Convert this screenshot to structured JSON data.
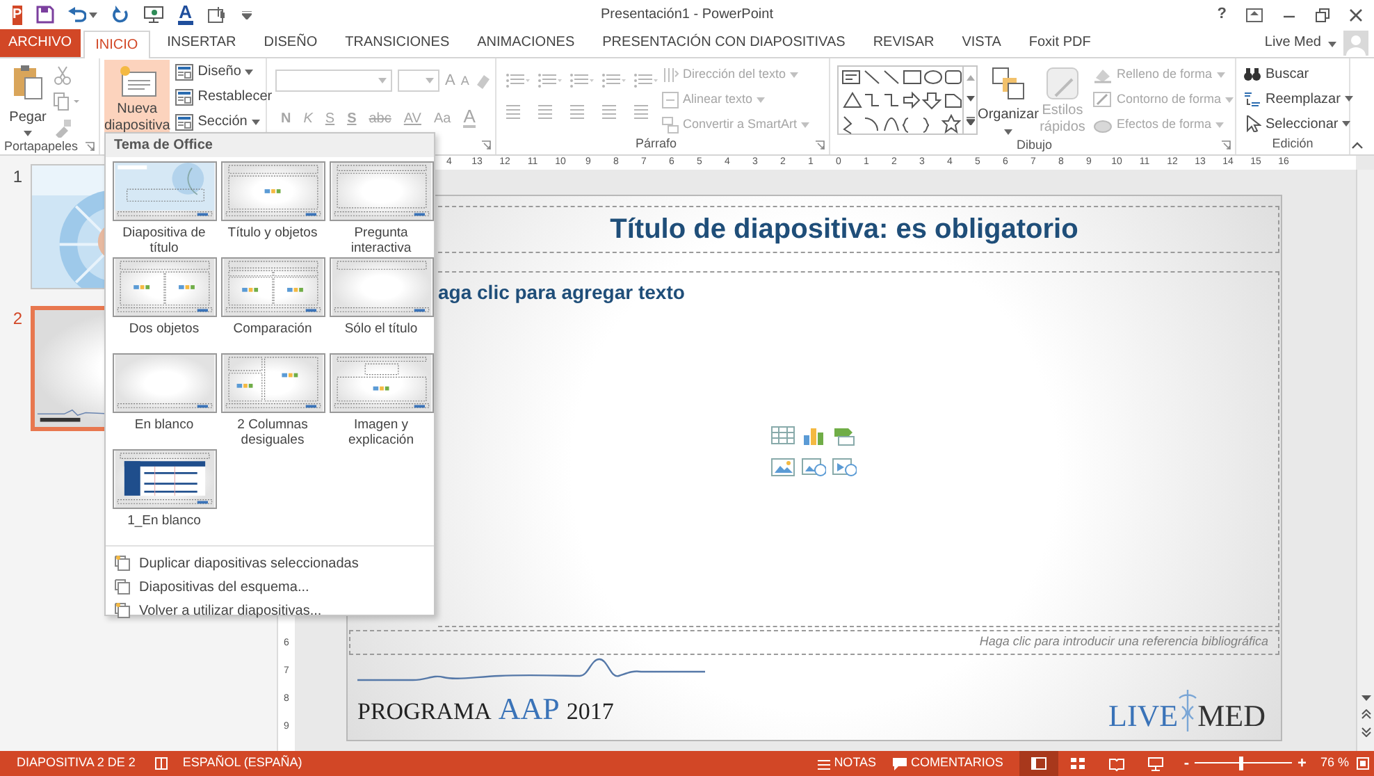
{
  "quick_access": [
    {
      "kind": "app",
      "label": "P"
    },
    {
      "kind": "save"
    },
    {
      "kind": "undo"
    },
    {
      "kind": "redo"
    },
    {
      "kind": "slideshow"
    },
    {
      "kind": "font_color",
      "label": "A"
    },
    {
      "kind": "touch"
    },
    {
      "kind": "customize"
    }
  ],
  "window": {
    "title": "Presentación1 - PowerPoint",
    "help": "?"
  },
  "tabs": [
    {
      "label": "ARCHIVO",
      "kind": "file",
      "selected": false
    },
    {
      "label": "INICIO",
      "kind": "tab",
      "selected": true
    },
    {
      "label": "INSERTAR",
      "kind": "tab",
      "selected": false
    },
    {
      "label": "DISEÑO",
      "kind": "tab",
      "selected": false
    },
    {
      "label": "TRANSICIONES",
      "kind": "tab",
      "selected": false
    },
    {
      "label": "ANIMACIONES",
      "kind": "tab",
      "selected": false
    },
    {
      "label": "PRESENTACIÓN CON DIAPOSITIVAS",
      "kind": "tab",
      "selected": false
    },
    {
      "label": "REVISAR",
      "kind": "tab",
      "selected": false
    },
    {
      "label": "VISTA",
      "kind": "tab",
      "selected": false
    },
    {
      "label": "Foxit PDF",
      "kind": "tab",
      "selected": false
    }
  ],
  "account": {
    "name": "Live Med"
  },
  "ribbon": {
    "clipboard": {
      "paste": "Pegar",
      "label": "Portapapeles"
    },
    "slides": {
      "new_slide": {
        "label": "Nueva diapositiva",
        "expanded": true
      },
      "items": [
        {
          "label": "Diseño",
          "dropdown": true
        },
        {
          "label": "Restablecer",
          "dropdown": false
        },
        {
          "label": "Sección",
          "dropdown": true
        }
      ]
    },
    "font": {
      "disabled": true,
      "grow": "A",
      "shrink": "A",
      "buttons": [
        {
          "label": "N",
          "kind": "bold"
        },
        {
          "label": "K",
          "kind": "italic"
        },
        {
          "label": "S",
          "kind": "underline"
        },
        {
          "label": "S",
          "kind": "shadow"
        },
        {
          "label": "abc",
          "kind": "strike"
        },
        {
          "label": "AV",
          "kind": "spacing"
        },
        {
          "label": "Aa",
          "kind": "case"
        },
        {
          "label": "A",
          "kind": "color"
        }
      ]
    },
    "paragraph": {
      "disabled": true,
      "label": "Párrafo",
      "items": [
        {
          "label": "Dirección del texto",
          "kind": "direction"
        },
        {
          "label": "Alinear texto",
          "kind": "align"
        },
        {
          "label": "Convertir a SmartArt",
          "kind": "smartart"
        }
      ]
    },
    "drawing": {
      "label": "Dibujo",
      "arrange": "Organizar",
      "quick_styles": {
        "label": "Estilos rápidos",
        "disabled": true
      },
      "items": [
        {
          "label": "Relleno de forma",
          "kind": "fill",
          "disabled": true
        },
        {
          "label": "Contorno de forma",
          "kind": "outline",
          "disabled": true
        },
        {
          "label": "Efectos de forma",
          "kind": "effects",
          "disabled": true
        }
      ]
    },
    "editing": {
      "label": "Edición",
      "items": [
        {
          "label": "Buscar",
          "kind": "find",
          "dropdown": false
        },
        {
          "label": "Reemplazar",
          "kind": "replace",
          "dropdown": true
        },
        {
          "label": "Seleccionar",
          "kind": "select",
          "dropdown": true
        }
      ]
    }
  },
  "slide_thumbnails": [
    {
      "number": "1",
      "kind": "picture",
      "selected": false
    },
    {
      "number": "2",
      "kind": "slide",
      "selected": true
    }
  ],
  "ruler": {
    "horizontal": [
      "4",
      "13",
      "12",
      "11",
      "10",
      "9",
      "8",
      "7",
      "6",
      "5",
      "4",
      "3",
      "2",
      "1",
      "0",
      "1",
      "2",
      "3",
      "4",
      "5",
      "6",
      "7",
      "8",
      "9",
      "10",
      "11",
      "12",
      "13",
      "14",
      "15",
      "16"
    ],
    "vertical": [
      "6",
      "7",
      "8",
      "9"
    ]
  },
  "slide": {
    "title": "Título de diapositiva: es obligatorio",
    "body": "aga clic para agregar texto",
    "reference": "Haga clic para introducir una referencia bibliográfica",
    "logo": [
      "PROGRAMA",
      "AAP",
      "2017"
    ],
    "brand": [
      "LIVE",
      "MED"
    ]
  },
  "layout_menu": {
    "header": "Tema de Office",
    "layouts": [
      {
        "label": "Diapositiva de título",
        "kind": "title"
      },
      {
        "label": "Título y objetos",
        "kind": "title_content"
      },
      {
        "label": "Pregunta interactiva",
        "kind": "question"
      },
      {
        "label": "Dos objetos",
        "kind": "two_content"
      },
      {
        "label": "Comparación",
        "kind": "comparison"
      },
      {
        "label": "Sólo el título",
        "kind": "title_only"
      },
      {
        "label": "En blanco",
        "kind": "blank"
      },
      {
        "label": "2 Columnas desiguales",
        "kind": "two_columns"
      },
      {
        "label": "Imagen y explicación",
        "kind": "picture_caption"
      },
      {
        "label": "1_En blanco",
        "kind": "table"
      }
    ],
    "commands": [
      {
        "label": "Duplicar diapositivas seleccionadas",
        "kind": "duplicate"
      },
      {
        "label": "Diapositivas del esquema...",
        "kind": "outline"
      },
      {
        "label": "Volver a utilizar diapositivas...",
        "kind": "reuse"
      }
    ]
  },
  "status_bar": {
    "slide": "DIAPOSITIVA 2 DE 2",
    "language": "ESPAÑOL (ESPAÑA)",
    "notes": "NOTAS",
    "comments": "COMENTARIOS",
    "views": [
      {
        "kind": "normal",
        "selected": true
      },
      {
        "kind": "sorter",
        "selected": false
      },
      {
        "kind": "reading",
        "selected": false
      },
      {
        "kind": "slideshow",
        "selected": false
      }
    ],
    "zoom": {
      "minus": "-",
      "plus": "+",
      "level": 0.48,
      "reading": "76 %"
    }
  }
}
